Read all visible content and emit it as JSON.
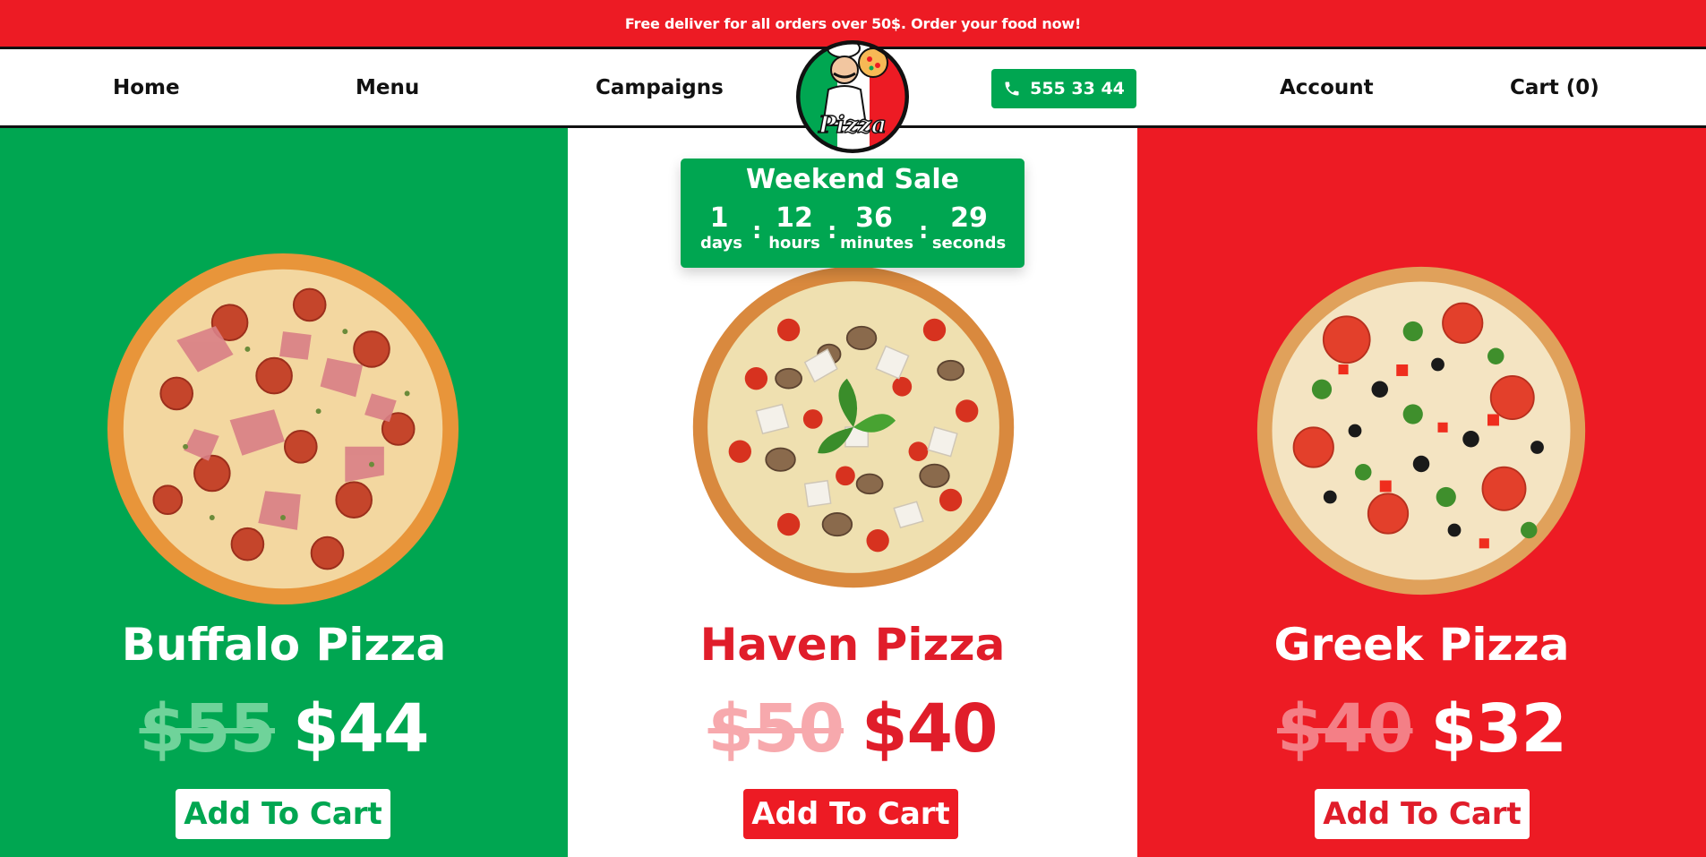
{
  "announcement": "Free deliver for all orders over 50$. Order your food now!",
  "nav": {
    "home": "Home",
    "menu": "Menu",
    "campaigns": "Campaigns",
    "phone": "555 33 44",
    "account": "Account",
    "cart": "Cart (0)"
  },
  "logo": {
    "text": "Pizza"
  },
  "sale": {
    "title": "Weekend Sale",
    "countdown": [
      {
        "value": "1",
        "label": "days"
      },
      {
        "value": "12",
        "label": "hours"
      },
      {
        "value": "36",
        "label": "minutes"
      },
      {
        "value": "29",
        "label": "seconds"
      }
    ],
    "separator": ":"
  },
  "products": [
    {
      "name": "Buffalo Pizza",
      "old_price": "$55",
      "new_price": "$44",
      "button": "Add To Cart"
    },
    {
      "name": "Haven Pizza",
      "old_price": "$50",
      "new_price": "$40",
      "button": "Add To Cart"
    },
    {
      "name": "Greek Pizza",
      "old_price": "$40",
      "new_price": "$32",
      "button": "Add To Cart"
    }
  ],
  "colors": {
    "brand_red": "#ed1b24",
    "brand_green": "#00a651",
    "white": "#ffffff"
  }
}
